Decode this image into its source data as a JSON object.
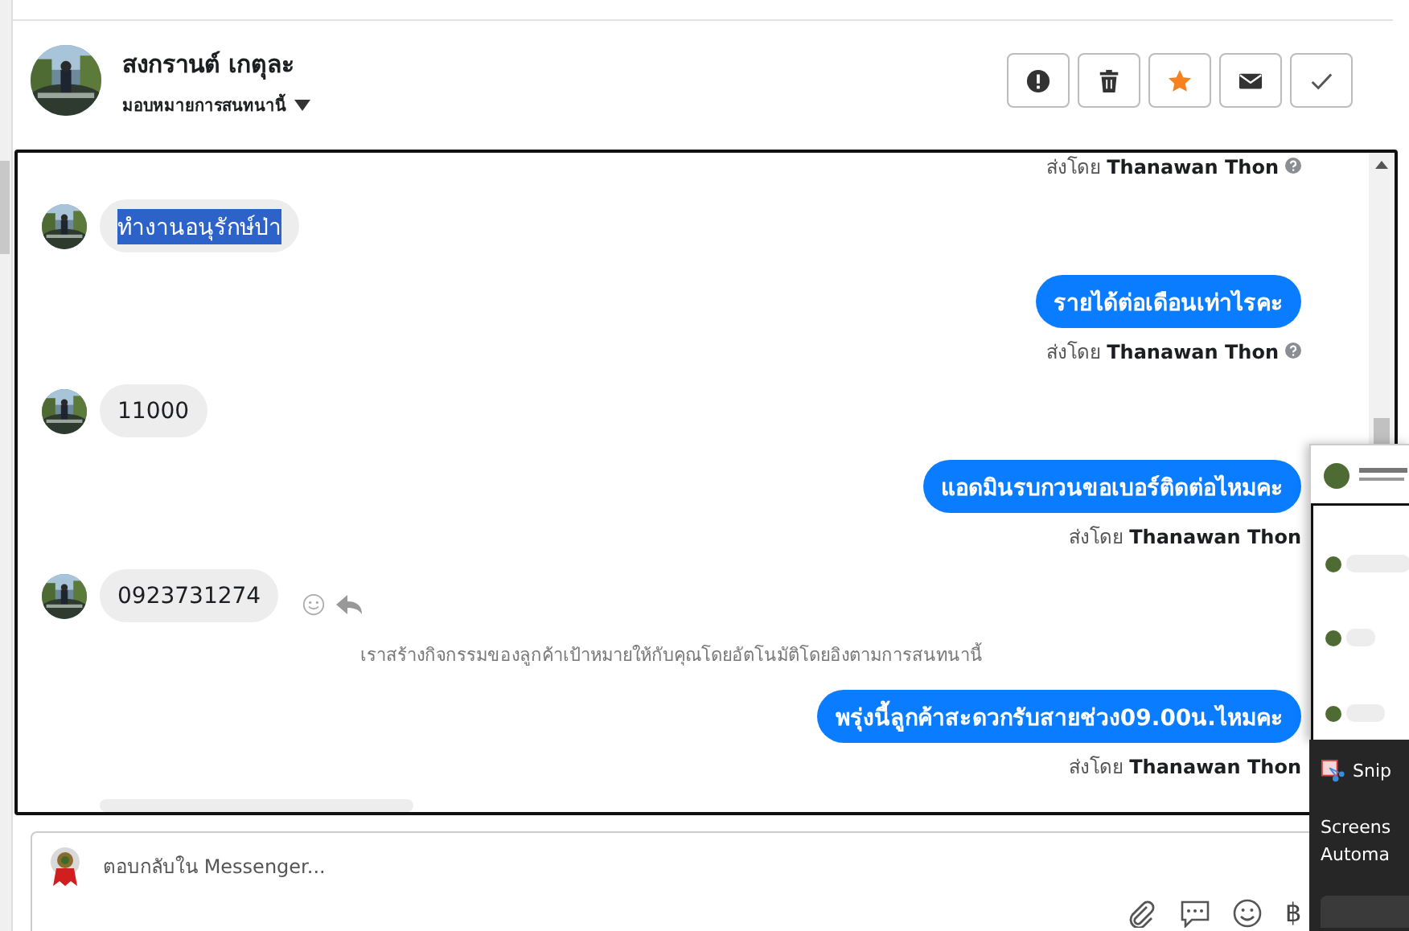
{
  "contact": {
    "name": "สงกรานต์ เกตุละ",
    "assign_label": "มอบหมายการสนทนานี้"
  },
  "actions": [
    {
      "kind": "alert",
      "on": false
    },
    {
      "kind": "trash",
      "on": false
    },
    {
      "kind": "star",
      "on": true
    },
    {
      "kind": "mail",
      "on": false
    },
    {
      "kind": "check",
      "on": false
    }
  ],
  "messages": [
    {
      "kind": "caption",
      "text": "ส่งโดย **Thanawan Thon**",
      "help_icon": true
    },
    {
      "kind": "incoming",
      "text": "ทำงานอนุรักษ์ป่า",
      "selected": true,
      "show_actions": false
    },
    {
      "kind": "outgoing",
      "text": "รายได้ต่อเดือนเท่าไรคะ",
      "caption": "ส่งโดย **Thanawan Thon**",
      "help_icon": true
    },
    {
      "kind": "incoming",
      "text": "11000",
      "selected": false,
      "show_actions": false
    },
    {
      "kind": "outgoing",
      "text": "แอดมินรบกวนขอเบอร์ติดต่อไหมคะ",
      "caption": "ส่งโดย **Thanawan Thon**",
      "help_icon": false
    },
    {
      "kind": "incoming",
      "text": "0923731274",
      "selected": false,
      "show_actions": true
    },
    {
      "kind": "system",
      "text": "เราสร้างกิจกรรมของลูกค้าเป้าหมายให้กับคุณโดยอัตโนมัติโดยอิงตามการสนทนานี้"
    },
    {
      "kind": "outgoing",
      "text": "พรุ่งนี้ลูกค้าสะดวกรับสายช่วง09.00น.ไหมคะ",
      "caption": "ส่งโดย **Thanawan Thon**",
      "help_icon": false
    },
    {
      "kind": "partial"
    }
  ],
  "composer": {
    "placeholder": "ตอบกลับใน Messenger..."
  },
  "composer_tools": [
    {
      "kind": "attach"
    },
    {
      "kind": "chat"
    },
    {
      "kind": "emoji"
    },
    {
      "kind": "baht",
      "text": "฿"
    }
  ],
  "toast": {
    "app": "Snip",
    "lines": [
      "Screens",
      "Automa"
    ]
  }
}
